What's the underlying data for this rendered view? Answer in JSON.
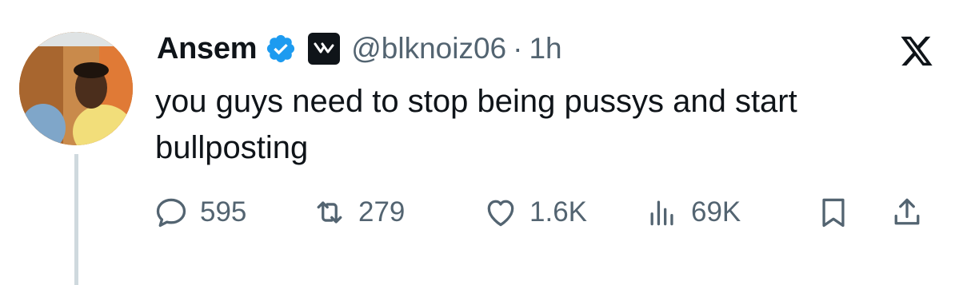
{
  "tweet": {
    "author_name": "Ansem",
    "handle": "@blknoiz06",
    "separator": "·",
    "time": "1h",
    "text": "you guys need to stop being pussys and start bullposting",
    "verified_icon": "verified-badge-icon",
    "affiliate_icon": "affiliate-logo-icon",
    "platform_icon": "x-logo-icon"
  },
  "actions": {
    "replies": "595",
    "reposts": "279",
    "likes": "1.6K",
    "views": "69K"
  },
  "colors": {
    "text": "#0f1419",
    "muted": "#536471",
    "verified": "#1d9bf0",
    "thread_line": "#cfd9de"
  }
}
